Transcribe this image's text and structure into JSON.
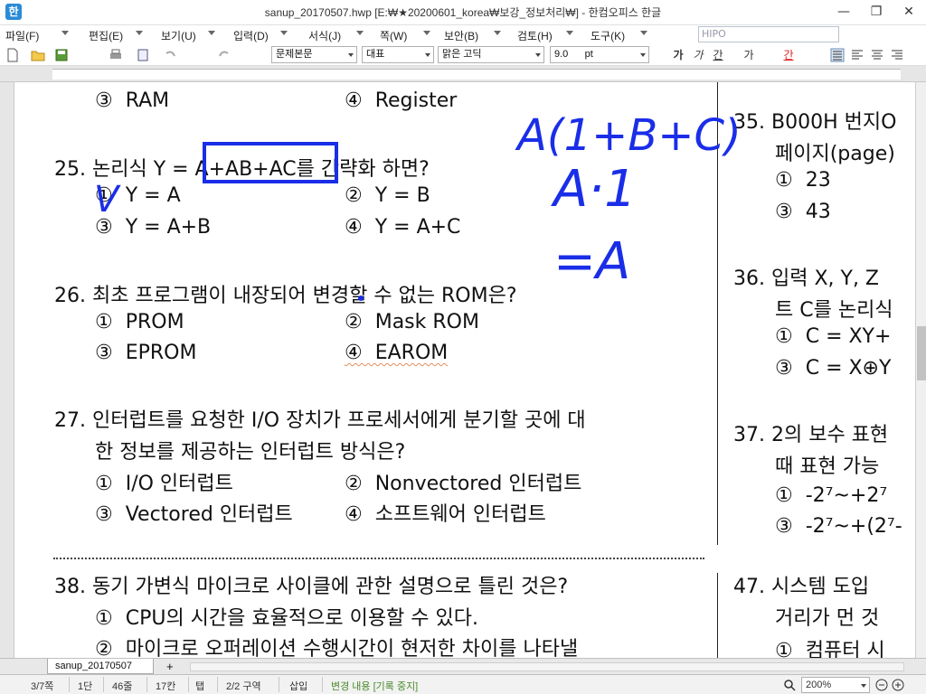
{
  "window": {
    "title": "sanup_20170507.hwp [E:₩★20200601_korea₩보강_정보처리₩] - 한컴오피스 한글",
    "app_icon_glyph": "한",
    "minimize": "—",
    "restore": "❐",
    "close": "✕"
  },
  "menu": {
    "items": [
      "파일(F)",
      "편집(E)",
      "보기(U)",
      "입력(D)",
      "서식(J)",
      "쪽(W)",
      "보안(B)",
      "검토(H)",
      "도구(K)"
    ],
    "search_placeholder": "HIPO"
  },
  "toolbar": {
    "style_combo": "문제본문",
    "lang_combo": "대표",
    "font_combo": "맑은 고딕",
    "size_combo": "9.0",
    "size_unit": "pt",
    "bold": "가",
    "italic": "가",
    "underline": "간",
    "strike": "가",
    "color": "간"
  },
  "document": {
    "q24_opt3": "③  RAM",
    "q24_opt4": "④  Register",
    "q25": "25. 논리식 Y = A+AB+AC를 간략화 하면?",
    "q25_opt1": "①  Y = A",
    "q25_opt2": "②  Y = B",
    "q25_opt3": "③  Y = A+B",
    "q25_opt4": "④  Y = A+C",
    "q26": "26. 최초 프로그램이 내장되어 변경할 수 없는 ROM은?",
    "q26_opt1": "①  PROM",
    "q26_opt2": "②  Mask ROM",
    "q26_opt3": "③  EPROM",
    "q26_opt4": "④  EAROM",
    "q27_line1": "27. 인터럽트를 요청한 I/O 장치가 프로세서에게 분기할 곳에 대",
    "q27_line2": "한 정보를 제공하는 인터럽트 방식은?",
    "q27_opt1": "①  I/O 인터럽트",
    "q27_opt2": "②  Nonvectored 인터럽트",
    "q27_opt3": "③  Vectored 인터럽트",
    "q27_opt4": "④  소프트웨어 인터럽트",
    "q38": "38. 동기 가변식 마이크로 사이클에 관한 설명으로 틀린 것은?",
    "q38_opt1": "①  CPU의 시간을 효율적으로 이용할 수 있다.",
    "q38_opt2": "②  마이크로 오퍼레이션 수행시간이 현저한 차이를 나타낼",
    "q35_line1": "35. B000H 번지O",
    "q35_line2": "페이지(page)",
    "q35_opt1": "①  23",
    "q35_opt3": "③  43",
    "q36_line1": "36. 입력 X, Y, Z",
    "q36_line2": "트 C를 논리식",
    "q36_opt1": "①  C = XY+",
    "q36_opt3": "③  C = X⊕Y",
    "q37_line1": "37. 2의 보수 표현",
    "q37_line2": "때 표현 가능",
    "q37_opt1": "①  -2⁷~+2⁷",
    "q37_opt3": "③  -2⁷~+(2⁷-",
    "q47_line1": "47. 시스템 도입",
    "q47_line2": "거리가 먼 것",
    "q47_opt1": "①  컴퓨터 시"
  },
  "annotations": {
    "line1": "A(1+B+C)",
    "line2": "A·1",
    "line3": "=A",
    "check": "V"
  },
  "tabs": {
    "doc_tab": "sanup_20170507",
    "add_tab": "+"
  },
  "status": {
    "page": "3/7쪽",
    "column": "1단",
    "line": "46줄",
    "char": "17칸",
    "tab": "탭",
    "section": "2/2 구역",
    "insert": "삽입",
    "track": "변경 내용 [기록 중지]",
    "zoom": "200%"
  },
  "colors": {
    "annotation_blue": "#1a2ee8",
    "squiggle": "#e09060"
  }
}
